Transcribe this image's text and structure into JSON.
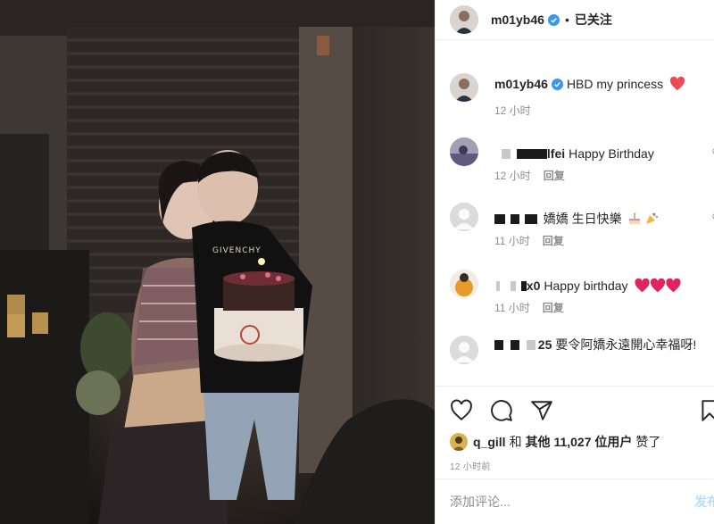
{
  "post": {
    "author": "m01yb46",
    "follow_status": "已关注",
    "caption": "HBD my princess",
    "caption_time": "12 小时"
  },
  "comments": [
    {
      "username": "lfei",
      "text": "Happy Birthday",
      "time": "12 小时",
      "reply": "回复"
    },
    {
      "username": "",
      "text": "嬌嬌 生日快樂",
      "time": "11 小时",
      "reply": "回复"
    },
    {
      "username": "x0",
      "text": "Happy birthday",
      "time": "11 小时",
      "reply": "回复"
    },
    {
      "username": "25",
      "text": "要令阿嬌永遠開心幸福呀!",
      "time": "",
      "reply": ""
    }
  ],
  "likes": {
    "liker": "q_gill",
    "conj": "和",
    "others_label": "其他 11,027 位用户",
    "suffix": "赞了"
  },
  "timestamp": "12 小时前",
  "comment_box": {
    "placeholder": "添加评论...",
    "post_label": "发布"
  },
  "icons": [
    "verified-badge-icon",
    "heart-icon",
    "comment-icon",
    "share-icon",
    "bookmark-icon",
    "party-popper-icon",
    "cake-emoji-icon"
  ],
  "photo_text": {
    "shirt": "GIVENCHY"
  },
  "colors": {
    "verified": "#3897f0",
    "heart": "#ed4956",
    "post_disabled": "#b2dffc",
    "meta": "#8e8e8e"
  }
}
